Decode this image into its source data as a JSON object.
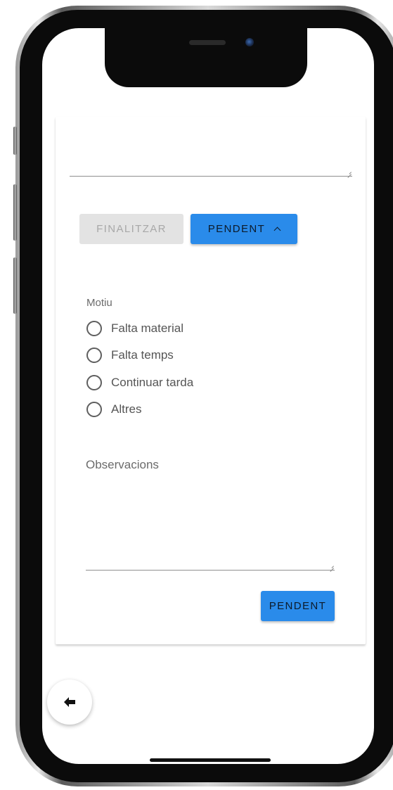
{
  "buttons": {
    "finalitzar": "FINALITZAR",
    "pendent_toggle": "PENDENT",
    "pendent_submit": "PENDENT"
  },
  "form": {
    "motiu_label": "Motiu",
    "options": [
      {
        "label": "Falta material",
        "selected": false
      },
      {
        "label": "Falta temps",
        "selected": false
      },
      {
        "label": "Continuar tarda",
        "selected": false
      },
      {
        "label": "Altres",
        "selected": false
      }
    ],
    "observacions_label": "Observacions",
    "observacions_value": ""
  },
  "icons": {
    "toggle": "chevron-up-icon",
    "back": "arrow-left-icon"
  },
  "colors": {
    "primary": "#2a8bea",
    "disabled": "#e3e3e3"
  }
}
